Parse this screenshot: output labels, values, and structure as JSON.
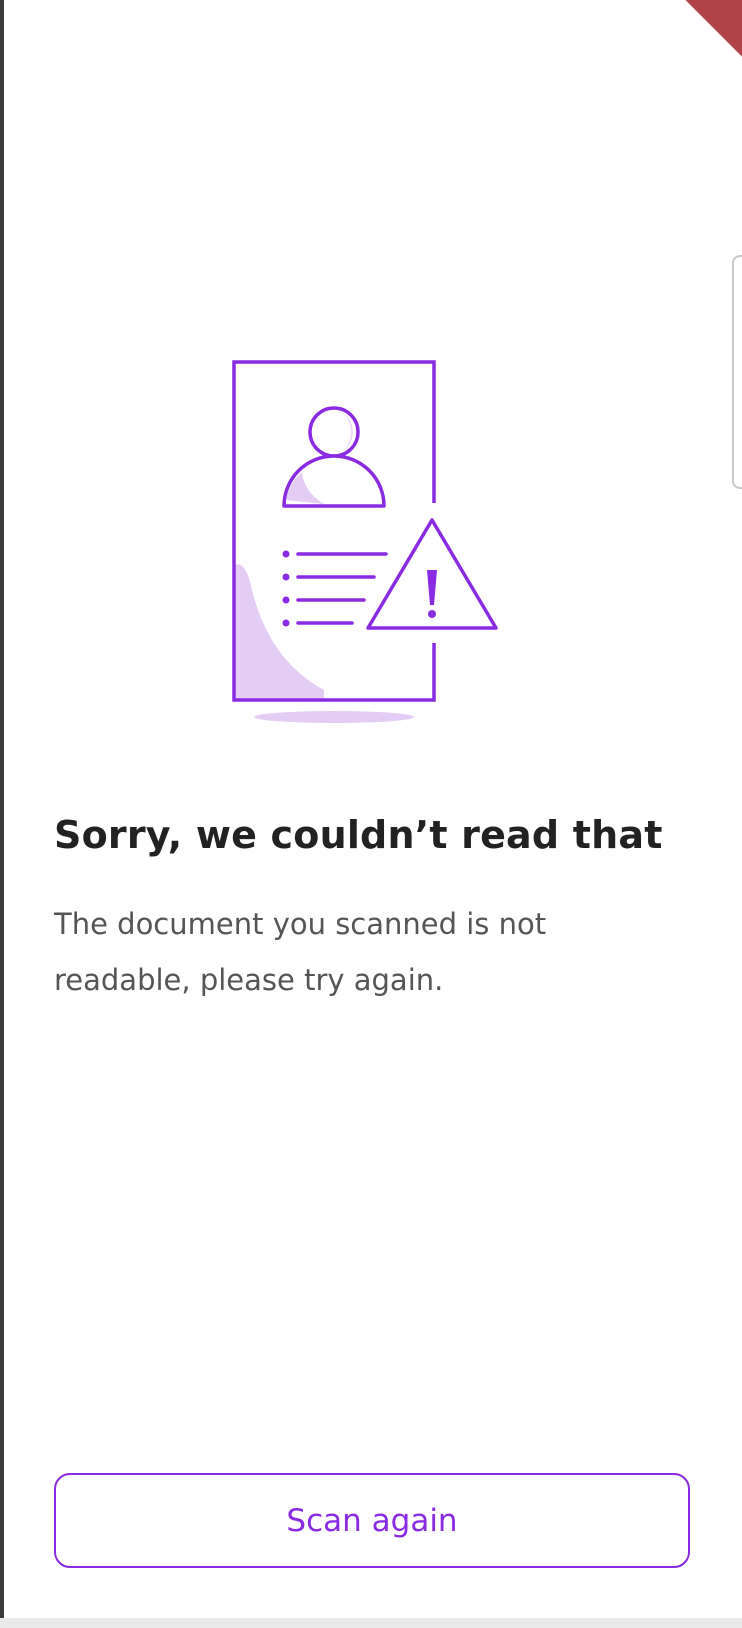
{
  "theme": {
    "accent": "#8a2be2",
    "accent_light": "#e3cdf5",
    "title_color": "#222222",
    "text_color": "#555555"
  },
  "illustration": {
    "icon": "unreadable-document-warning-icon"
  },
  "error": {
    "title": "Sorry, we couldn’t read that",
    "message": "The document you scanned is not readable, please try again."
  },
  "actions": {
    "scan_again_label": "Scan again"
  }
}
